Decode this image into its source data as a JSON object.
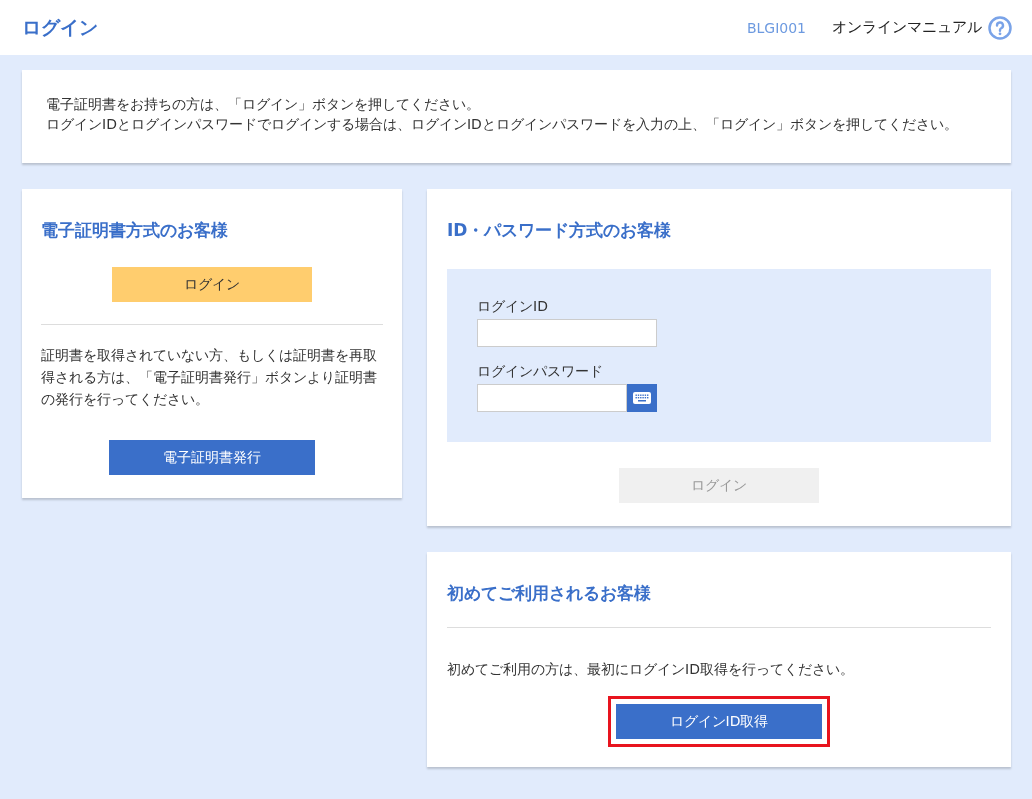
{
  "header": {
    "title": "ログイン",
    "screen_id": "BLGI001",
    "manual_link": "オンラインマニュアル"
  },
  "notice": {
    "lines": [
      "電子証明書をお持ちの方は、「ログイン」ボタンを押してください。",
      "ログインIDとログインパスワードでログインする場合は、ログインIDとログインパスワードを入力の上、「ログイン」ボタンを押してください。"
    ]
  },
  "certificate_panel": {
    "title": "電子証明書方式のお客様",
    "login_button": {
      "label": "ログイン",
      "disabled": false
    },
    "description": "証明書を取得されていない方、もしくは証明書を再取得される方は、「電子証明書発行」ボタンより証明書の発行を行ってください。",
    "issue_button": {
      "label": "電子証明書発行",
      "disabled": false
    }
  },
  "password_panel": {
    "title": "ID・パスワード方式のお客様",
    "fields": [
      {
        "label": "ログインID",
        "kind": "text"
      },
      {
        "label": "ログインパスワード",
        "kind": "password"
      }
    ],
    "login_button": {
      "label": "ログイン",
      "disabled": true
    }
  },
  "first_time_panel": {
    "title": "初めてご利用されるお客様",
    "description": "初めてご利用の方は、最初にログインID取得を行ってください。",
    "button": {
      "label": "ログインID取得",
      "highlighted": true,
      "disabled": false
    }
  }
}
